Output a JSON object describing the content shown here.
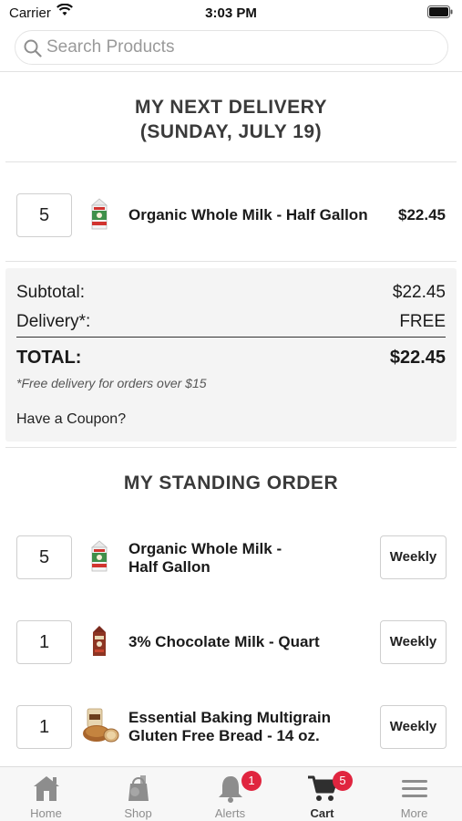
{
  "status_bar": {
    "carrier": "Carrier",
    "time": "3:03 PM"
  },
  "search": {
    "placeholder": "Search Products",
    "value": ""
  },
  "next_delivery": {
    "title_line1": "MY NEXT DELIVERY",
    "title_line2": "(SUNDAY, JULY 19)",
    "items": [
      {
        "qty": "5",
        "name": "Organic Whole Milk - Half Gallon",
        "price": "$22.45",
        "image": "milk-carton"
      }
    ]
  },
  "totals": {
    "subtotal_label": "Subtotal:",
    "subtotal_value": "$22.45",
    "delivery_label": "Delivery*:",
    "delivery_value": "FREE",
    "total_label": "TOTAL:",
    "total_value": "$22.45",
    "note": "*Free delivery for orders over $15",
    "coupon": "Have a Coupon?"
  },
  "standing_order": {
    "title": "MY STANDING ORDER",
    "items": [
      {
        "qty": "5",
        "name_line1": "Organic Whole Milk -",
        "name_line2": "Half Gallon",
        "frequency": "Weekly",
        "image": "milk-carton"
      },
      {
        "qty": "1",
        "name_line1": "3% Chocolate Milk - Quart",
        "name_line2": "",
        "frequency": "Weekly",
        "image": "chocolate-milk-carton"
      },
      {
        "qty": "1",
        "name_line1": "Essential Baking Multigrain",
        "name_line2": "Gluten Free Bread - 14 oz.",
        "frequency": "Weekly",
        "image": "bread-loaf"
      }
    ]
  },
  "tabbar": {
    "tabs": [
      {
        "label": "Home",
        "icon": "home-icon",
        "badge": ""
      },
      {
        "label": "Shop",
        "icon": "shop-bag-icon",
        "badge": ""
      },
      {
        "label": "Alerts",
        "icon": "bell-icon",
        "badge": "1"
      },
      {
        "label": "Cart",
        "icon": "cart-icon",
        "badge": "5",
        "active": true
      },
      {
        "label": "More",
        "icon": "menu-icon",
        "badge": ""
      }
    ]
  },
  "colors": {
    "badge": "#e0253f",
    "tab_inactive": "#8d8d8d",
    "tab_active": "#2f2f2f",
    "totals_bg": "#f4f4f4"
  }
}
